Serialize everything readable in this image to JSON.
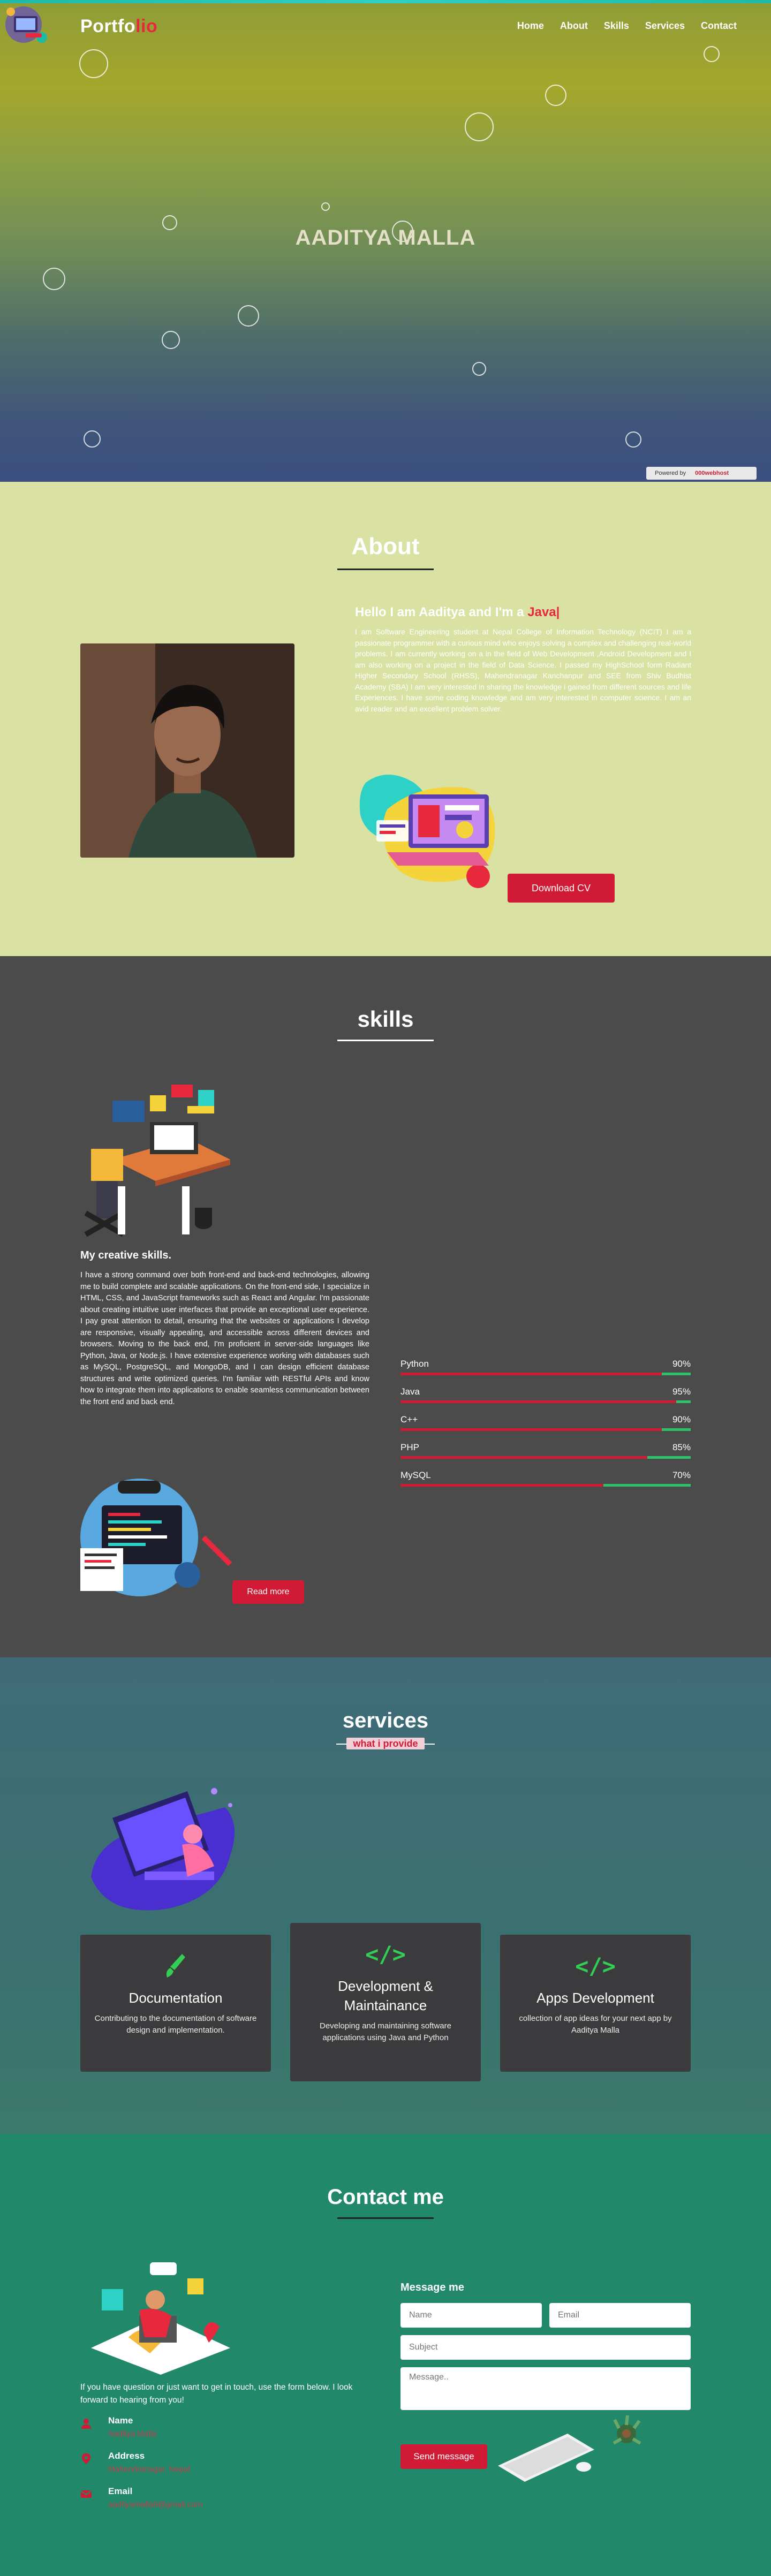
{
  "nav": {
    "brand_part1": "Portfo",
    "brand_part2": "lio",
    "links": [
      "Home",
      "About",
      "Skills",
      "Services",
      "Contact"
    ]
  },
  "hero": {
    "name": "AADITYA MALLA",
    "powered": "Powered by",
    "powered_brand": "000webhost"
  },
  "about": {
    "title": "About",
    "hello_prefix": "Hello I am Aaditya and I'm a ",
    "hello_highlight": "Java|",
    "text": "I am Software Engineering student at Nepal College of Information Technology (NCIT) I am a passionate programmer with a curious mind who enjoys solving a complex and challenging real-world problems. I am currently working on a in the field of Web Development ,Android Development and I am also working on a project in the field of Data Science. I passed my HighSchool form Radiant Higher Secondary School (RHSS), Mahendranagar Kanchanpur and SEE from Shiv Budhist Academy (SBA) I am very interested in sharing the knowledge i gained from different sources and life Experiences. I have some coding knowledge and am very interested in computer science. I am an avid reader and an excellent problem solver.",
    "cv_button": "Download CV"
  },
  "skills": {
    "title": "skills",
    "subtitle": "My creative skills.",
    "text": "I have a strong command over both front-end and back-end technologies, allowing me to build complete and scalable applications. On the front-end side, I specialize in HTML, CSS, and JavaScript frameworks such as React and Angular. I'm passionate about creating intuitive user interfaces that provide an exceptional user experience. I pay great attention to detail, ensuring that the websites or applications I develop are responsive, visually appealing, and accessible across different devices and browsers. Moving to the back end, I'm proficient in server-side languages like Python, Java, or Node.js. I have extensive experience working with databases such as MySQL, PostgreSQL, and MongoDB, and I can design efficient database structures and write optimized queries. I'm familiar with RESTful APIs and know how to integrate them into applications to enable seamless communication between the front end and back end.",
    "read_more": "Read more",
    "bars": [
      {
        "name": "Python",
        "percent_label": "90%",
        "value": 0.9
      },
      {
        "name": "Java",
        "percent_label": "95%",
        "value": 0.95
      },
      {
        "name": "C++",
        "percent_label": "90%",
        "value": 0.9
      },
      {
        "name": "PHP",
        "percent_label": "85%",
        "value": 0.85
      },
      {
        "name": "MySQL",
        "percent_label": "70%",
        "value": 0.7
      }
    ]
  },
  "services": {
    "title": "services",
    "tag": "what i provide",
    "cards": [
      {
        "icon": "brush-icon",
        "title": "Documentation",
        "text": "Contributing to the documentation of software design and implementation."
      },
      {
        "icon": "code-icon",
        "title": "Development & Maintainance",
        "text": "Developing and maintaining software applications using Java and Python"
      },
      {
        "icon": "code-icon",
        "title": "Apps Development",
        "text": "collection of app ideas for your next app by Aaditya Malla"
      }
    ]
  },
  "contact": {
    "title": "Contact me",
    "lead": "If you have question or just want to get in touch, use the form below. I look forward to hearing from you!",
    "info": [
      {
        "icon": "user-icon",
        "label": "Name",
        "value": "Aaditya Malla"
      },
      {
        "icon": "location-icon",
        "label": "Address",
        "value": "Mahendranagar, Nepal"
      },
      {
        "icon": "mail-icon",
        "label": "Email",
        "value": "aadityamalla9@gmail.com"
      }
    ],
    "form_title": "Message me",
    "name_placeholder": "Name",
    "email_placeholder": "Email",
    "subject_placeholder": "Subject",
    "message_placeholder": "Message..",
    "send_button": "Send message"
  },
  "colors": {
    "accent": "#d11b36",
    "skill_track": "#2cc36b"
  }
}
